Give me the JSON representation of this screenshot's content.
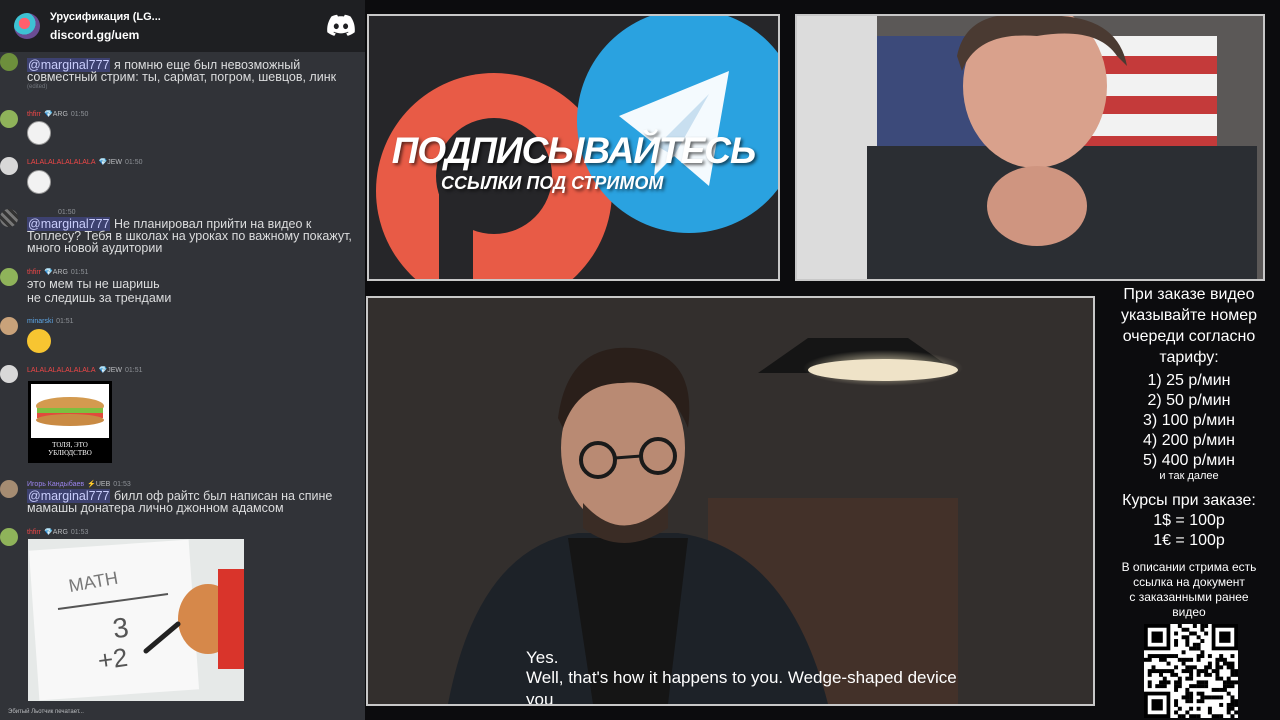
{
  "discord": {
    "server_name": "Урусификация (LG...",
    "invite": "discord.gg/uem",
    "logo_icon": "discord-logo-icon",
    "typing_indicator": "Эбитый Льотчик печатает...",
    "messages": [
      {
        "id": "m1",
        "text_parts": [
          {
            "mention": "@marginal777"
          },
          {
            "text": " я помню еще был невозможный совместный стрим: ты, сармат, погром, шевцов, линк"
          }
        ],
        "edited": "(edited)"
      },
      {
        "id": "m2",
        "author": "thfirr",
        "badge": "💎ARG",
        "time": "01:50",
        "emoji": "trollface-emoji"
      },
      {
        "id": "m3",
        "author": "LALALALALALALALA",
        "badge": "💎JEW",
        "time": "01:50",
        "emoji": "trollface-emoji"
      },
      {
        "id": "m4",
        "time": "01:50",
        "text_parts": [
          {
            "mention": "@marginal777"
          },
          {
            "text": " Не планировал прийти на видео к Топлесу? Тебя в школах на уроках по важному покажут, много новой аудитории"
          }
        ]
      },
      {
        "id": "m5",
        "author": "thfirr",
        "badge": "💎ARG",
        "time": "01:51",
        "lines": [
          "это мем ты не шаришь",
          "не следишь за трендами"
        ]
      },
      {
        "id": "m6",
        "author": "minarski",
        "time": "01:51",
        "emoji": "laughing-emoji"
      },
      {
        "id": "m7",
        "author": "LALALALALALALALA",
        "badge": "💎JEW",
        "time": "01:51",
        "image_caption": "ТОЛЯ, ЭТО\nУБЛЮДСТВО"
      },
      {
        "id": "m8",
        "author": "Игорь Кандыбаев",
        "badge": "⚡UEB",
        "time": "01:53",
        "text_parts": [
          {
            "mention": "@marginal777"
          },
          {
            "text": " билл оф райтс был написан на спине мамашы донатера лично джонном адамсом"
          }
        ]
      },
      {
        "id": "m9",
        "author": "thfirr",
        "badge": "💎ARG",
        "time": "01:53",
        "gif_text": [
          "MATH",
          "3",
          "+2"
        ]
      }
    ]
  },
  "banner": {
    "title": "ПОДПИСЫВАЙТЕСЬ",
    "subtitle": "ССЫЛКИ ПОД СТРИМОМ",
    "icons": [
      "patreon-icon",
      "telegram-icon"
    ]
  },
  "webcam": {
    "description_icon": "streamer-webcam"
  },
  "video": {
    "subtitles": [
      "Yes.",
      "Well, that's how it happens to you. Wedge-shaped device",
      "you"
    ]
  },
  "info": {
    "order_heading": [
      "При заказе видео",
      "указывайте номер",
      "очереди согласно",
      "тарифу:"
    ],
    "tiers": [
      "1) 25 р/мин",
      "2) 50 р/мин",
      "3) 100 р/мин",
      "4) 200 р/мин",
      "5) 400 р/мин"
    ],
    "and_so_on": "и так далее",
    "rates_heading": "Курсы при заказе:",
    "rates": [
      "1$ = 100р",
      "1€ = 100р"
    ],
    "description_note": [
      "В описании стрима есть",
      "ссылка на документ",
      "с заказанными ранее",
      "видео"
    ],
    "qr_icon": "qr-code"
  },
  "colors": {
    "discord_bg": "#313338",
    "header_bg": "#1e1f22",
    "mention": "#c9cdfb",
    "username_red": "#f04747",
    "username_purple": "#9b84ee",
    "patreon": "#e85b46",
    "telegram": "#2aa2e0"
  }
}
